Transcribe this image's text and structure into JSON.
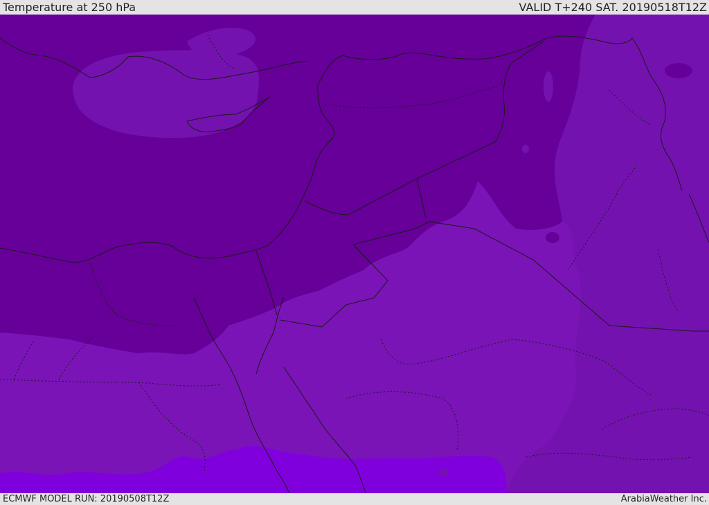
{
  "header": {
    "title": "Temperature at 250 hPa",
    "valid": "VALID T+240 SAT. 20190518T12Z"
  },
  "footer": {
    "model_run": "ECMWF MODEL RUN: 20190508T12Z",
    "credit": "ArabiaWeather Inc."
  },
  "colors": {
    "header_bg": "#e4e4e4",
    "text": "#222222",
    "band_coldest": "#660099",
    "band_cold": "#7412b0",
    "band_mid": "#7a14b6",
    "band_warm": "#8000dd",
    "coastline": "#1a1a1a",
    "border": "#1a1a1a"
  }
}
